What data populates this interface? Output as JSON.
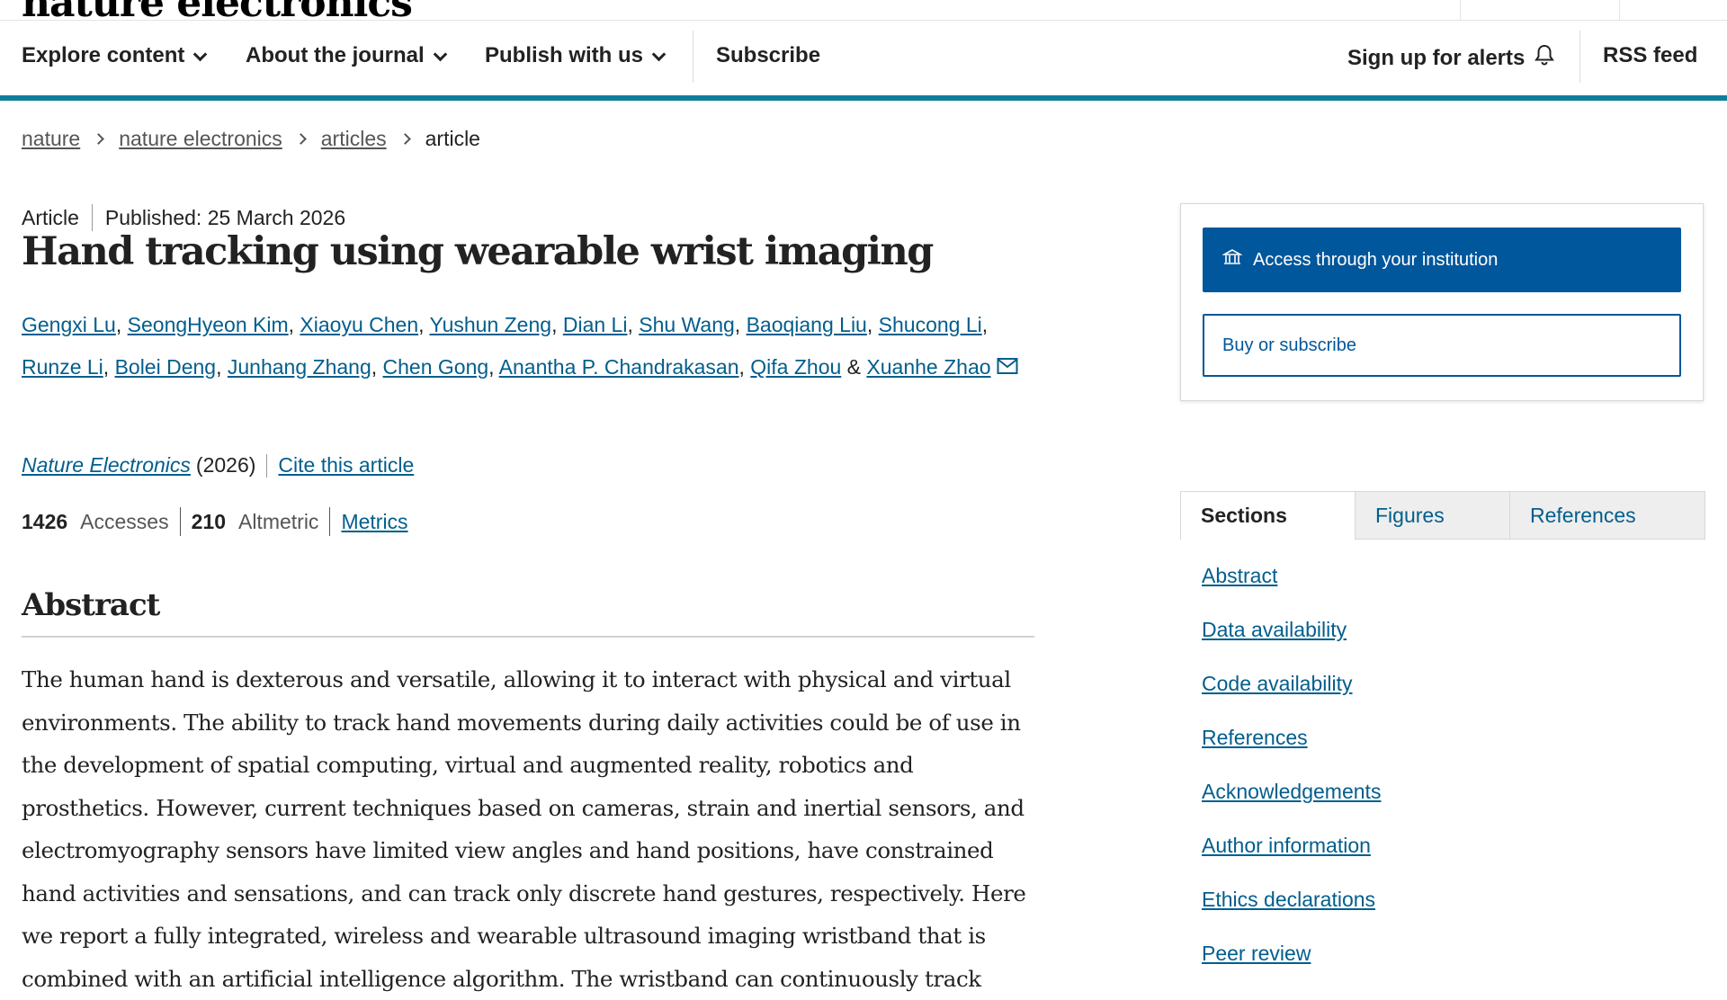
{
  "site": {
    "logo_text": "nature electronics"
  },
  "nav": {
    "items": [
      "Explore content",
      "About the journal",
      "Publish with us"
    ],
    "subscribe": "Subscribe",
    "alerts": "Sign up for alerts",
    "rss": "RSS feed"
  },
  "breadcrumb": {
    "items": [
      "nature",
      "nature electronics",
      "articles"
    ],
    "current": "article"
  },
  "article": {
    "type": "Article",
    "published": "Published: 25 March 2026",
    "title": "Hand tracking using wearable wrist imaging",
    "authors": [
      "Gengxi Lu",
      "SeongHyeon Kim",
      "Xiaoyu Chen",
      "Yushun Zeng",
      "Dian Li",
      "Shu Wang",
      "Baoqiang Liu",
      "Shucong Li",
      "Runze Li",
      "Bolei Deng",
      "Junhang Zhang",
      "Chen Gong",
      "Anantha P. Chandrakasan",
      "Qifa Zhou",
      "Xuanhe Zhao"
    ],
    "journal": "Nature Electronics",
    "year": "(2026)",
    "cite": "Cite this article",
    "accesses_count": "1426",
    "accesses_label": "Accesses",
    "altmetric_count": "210",
    "altmetric_label": "Altmetric",
    "metrics_link": "Metrics"
  },
  "abstract": {
    "heading": "Abstract",
    "text": "The human hand is dexterous and versatile, allowing it to interact with physical and virtual environments. The ability to track hand movements during daily activities could be of use in the development of spatial computing, virtual and augmented reality, robotics and prosthetics. However, current techniques based on cameras, strain and inertial sensors, and electromyography sensors have limited view angles and hand positions, have constrained hand activities and sensations, and can track only discrete hand gestures, respectively. Here we report a fully integrated, wireless and wearable ultrasound imaging wristband that is combined with an artificial intelligence algorithm. The wristband can continuously track"
  },
  "access": {
    "institution_button": "Access through your institution",
    "buy_button": "Buy or subscribe"
  },
  "tabs": {
    "sections": "Sections",
    "figures": "Figures",
    "references": "References"
  },
  "sections": [
    "Abstract",
    "Data availability",
    "Code availability",
    "References",
    "Acknowledgements",
    "Author information",
    "Ethics declarations",
    "Peer review"
  ],
  "colors": {
    "brand_blue": "#01579b",
    "link": "#025e8d",
    "nav_accent": "#0f7e9b"
  },
  "icons": {
    "alerts": "bell-icon",
    "email": "envelope-icon",
    "institution": "institution-icon"
  }
}
